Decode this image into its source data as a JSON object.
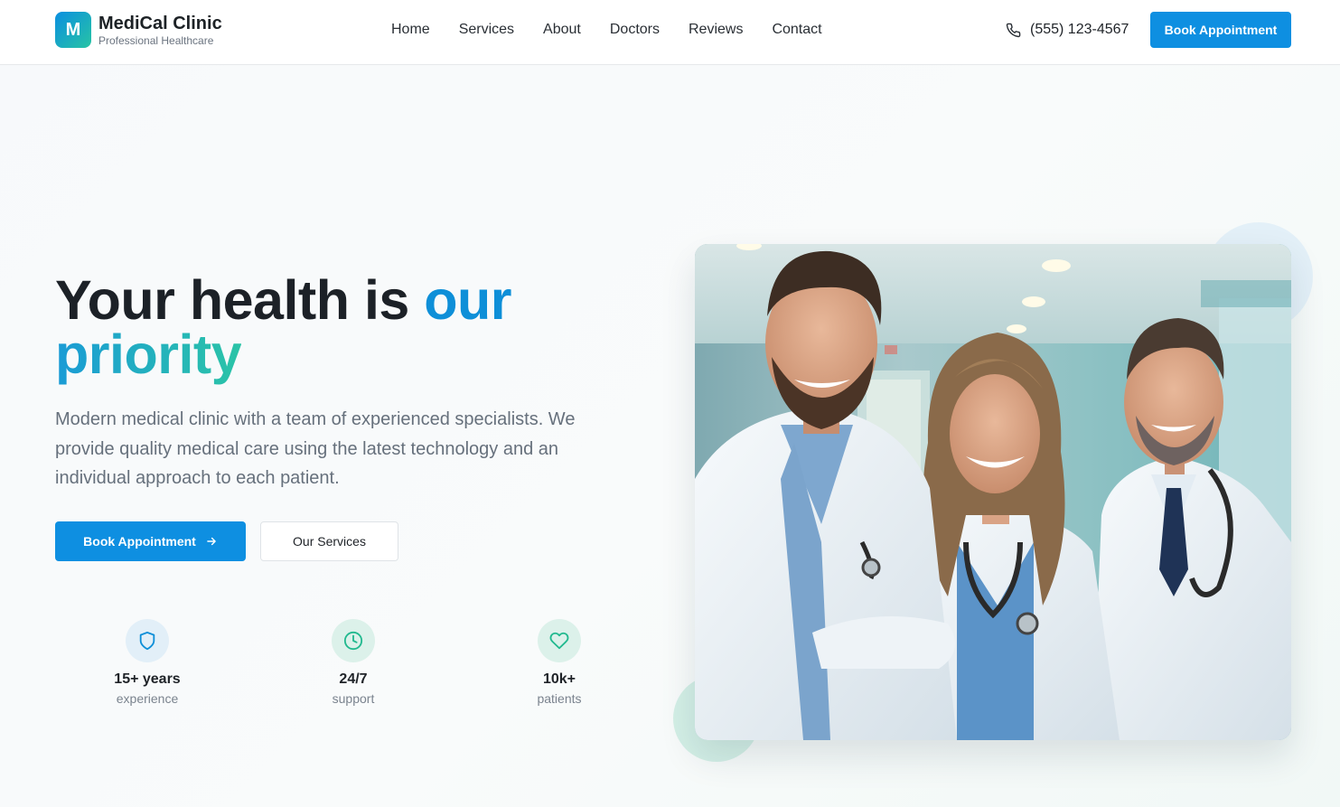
{
  "brand": {
    "mark": "M",
    "name": "MediCal Clinic",
    "tagline": "Professional Healthcare",
    "gradient_from": "#0b8fe0",
    "gradient_to": "#27c4a4"
  },
  "nav": {
    "items": [
      {
        "label": "Home"
      },
      {
        "label": "Services"
      },
      {
        "label": "About"
      },
      {
        "label": "Doctors"
      },
      {
        "label": "Reviews"
      },
      {
        "label": "Contact"
      }
    ]
  },
  "header": {
    "phone": "(555) 123-4567",
    "phone_icon": "phone-icon",
    "cta_label": "Book Appointment"
  },
  "hero": {
    "title_part1": "Your health is ",
    "title_accent": "our",
    "title_accent2": "priority",
    "description": "Modern medical clinic with a team of experienced specialists. We provide quality medical care using the latest technology and an individual approach to each patient.",
    "primary_cta": "Book Appointment",
    "primary_cta_icon": "arrow-right-icon",
    "secondary_cta": "Our Services",
    "image_icon": "doctors-photo"
  },
  "stats": [
    {
      "value": "15+ years",
      "label": "experience",
      "icon": "shield-icon",
      "color": "#0e8fd8",
      "bg": "#e2eff8"
    },
    {
      "value": "24/7",
      "label": "support",
      "icon": "clock-icon",
      "color": "#22b98f",
      "bg": "#dcf1ea"
    },
    {
      "value": "10k+",
      "label": "patients",
      "icon": "heart-icon",
      "color": "#22b98f",
      "bg": "#dcf1ea"
    }
  ],
  "colors": {
    "primary": "#0e8fe1",
    "accent_teal": "#2bc4a7",
    "text_dark": "#1c2127",
    "text_muted": "#66707c"
  }
}
